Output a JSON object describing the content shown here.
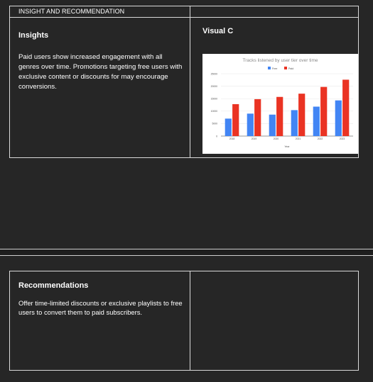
{
  "header": {
    "left_title": "INSIGHT AND RECOMMENDATION",
    "right_title": ""
  },
  "insights": {
    "title": "Insights",
    "text": "Paid users show increased engagement with all genres over time. Promotions targeting free users with exclusive content or discounts for may encourage conversions."
  },
  "visual": {
    "title": "Visual C"
  },
  "recommendations": {
    "title": "Recommendations",
    "text": "Offer time-limited discounts or exclusive playlists to free users to convert them to paid subscribers."
  },
  "colors": {
    "free": "#4285f4",
    "paid": "#ea3323",
    "background": "#262626",
    "border": "#d9d9d9"
  },
  "chart_data": {
    "type": "bar",
    "title": "Tracks listened by user tier over time",
    "xlabel": "Year",
    "ylabel": "",
    "categories": [
      "2018",
      "2019",
      "2020",
      "2021",
      "2022",
      "2023"
    ],
    "series": [
      {
        "name": "Free",
        "values": [
          7000,
          9000,
          8600,
          10400,
          11800,
          14300
        ]
      },
      {
        "name": "Paid",
        "values": [
          12800,
          14800,
          15700,
          17000,
          19700,
          22600
        ]
      }
    ],
    "ylim": [
      0,
      25000
    ],
    "yticks": [
      "0",
      "5000",
      "10000",
      "15000",
      "20000",
      "25000"
    ],
    "legend": "top-center",
    "grid": true
  }
}
